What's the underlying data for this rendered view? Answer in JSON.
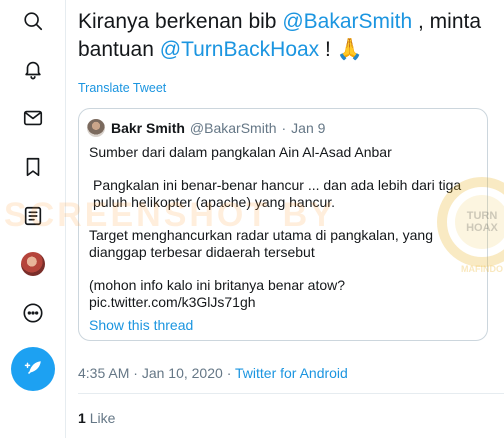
{
  "nav": {
    "items": [
      {
        "name": "search",
        "icon": "search-icon"
      },
      {
        "name": "notifications",
        "icon": "bell-icon"
      },
      {
        "name": "messages",
        "icon": "envelope-icon"
      },
      {
        "name": "bookmarks",
        "icon": "bookmark-icon"
      },
      {
        "name": "lists",
        "icon": "list-icon"
      },
      {
        "name": "profile",
        "icon": "avatar"
      },
      {
        "name": "more",
        "icon": "more-icon"
      }
    ],
    "compose_icon": "feather-plus-icon"
  },
  "tweet": {
    "text_part1": "Kiranya berkenan bib ",
    "mention1": "@BakarSmith",
    "text_part2": " , minta bantuan ",
    "mention2": "@TurnBackHoax",
    "text_part3": " ! 🙏",
    "translate_label": "Translate Tweet",
    "time": "4:35 AM",
    "date": "Jan 10, 2020",
    "source": "Twitter for Android",
    "likes_count": "1",
    "likes_label": "Like"
  },
  "quoted": {
    "name": "Bakr Smith",
    "handle": "@BakarSmith",
    "separator": "·",
    "date": "Jan 9",
    "line1": "Sumber dari dalam pangkalan Ain Al-Asad Anbar",
    "line2": "Pangkalan ini benar-benar hancur ... dan ada lebih dari tiga puluh helikopter (apache) yang hancur.",
    "line3": "Target menghancurkan radar utama di pangkalan, yang dianggap terbesar didaerah tersebut",
    "line4": "(mohon info kalo ini britanya benar atow?",
    "line5": "pic.twitter.com/k3GlJs71gh",
    "show_thread": "Show this thread"
  },
  "watermark": {
    "text": "SCREENSHOT BY",
    "seal_text": "TURN BACK HOAX",
    "seal_org": "MAFINDO"
  },
  "colors": {
    "accent": "#1da1f2",
    "link": "#1b95e0",
    "text": "#14171a",
    "secondary": "#657786",
    "border": "#ccd6dd"
  }
}
